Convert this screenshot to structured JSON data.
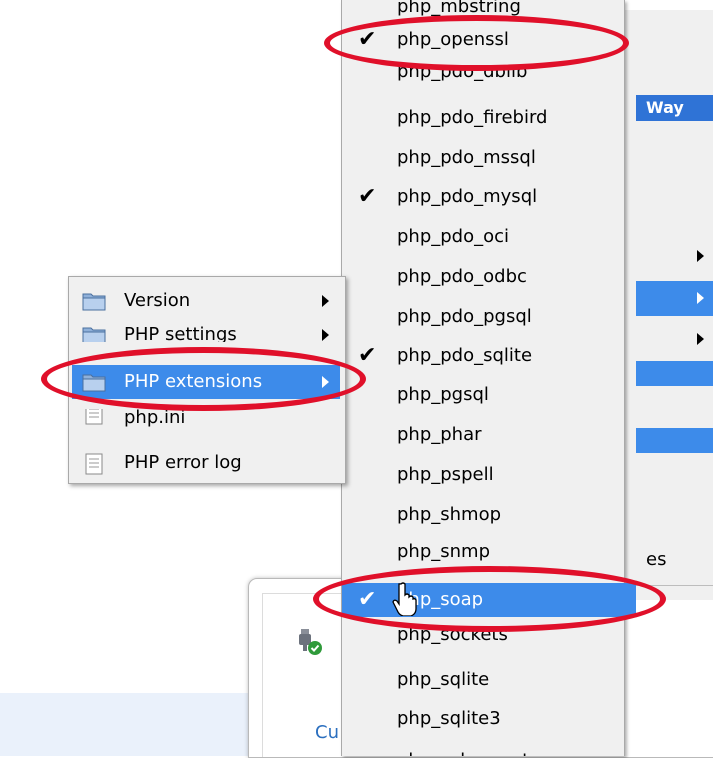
{
  "background_menu": {
    "header_label": "Way",
    "partial_text": "es"
  },
  "extensions_menu": {
    "items": [
      {
        "label": "php_openssl",
        "checked": true
      },
      {
        "label": "php_pdo_dblib",
        "checked": false
      },
      {
        "label": "php_pdo_firebird",
        "checked": false
      },
      {
        "label": "php_pdo_mssql",
        "checked": false
      },
      {
        "label": "php_pdo_mysql",
        "checked": true
      },
      {
        "label": "php_pdo_oci",
        "checked": false
      },
      {
        "label": "php_pdo_odbc",
        "checked": false
      },
      {
        "label": "php_pdo_pgsql",
        "checked": false
      },
      {
        "label": "php_pdo_sqlite",
        "checked": true
      },
      {
        "label": "php_pgsql",
        "checked": false
      },
      {
        "label": "php_phar",
        "checked": false
      },
      {
        "label": "php_pspell",
        "checked": false
      },
      {
        "label": "php_shmop",
        "checked": false
      },
      {
        "label": "php_snmp",
        "checked": false
      },
      {
        "label": "php_soap",
        "checked": true,
        "highlighted": true
      },
      {
        "label": "php_sockets",
        "checked": false
      },
      {
        "label": "php_sqlite",
        "checked": false
      },
      {
        "label": "php_sqlite3",
        "checked": false
      },
      {
        "label": "php_sybase_ct",
        "checked": false
      }
    ],
    "check_glyph": "✔"
  },
  "php_menu": {
    "items": [
      {
        "label": "Version",
        "icon": "folder-icon",
        "submenu": true
      },
      {
        "label": "PHP settings",
        "icon": "folder-icon",
        "submenu": true
      },
      {
        "label": "PHP extensions",
        "icon": "folder-icon",
        "submenu": true,
        "highlighted": true
      },
      {
        "label": "php.ini",
        "icon": "document-icon",
        "submenu": false
      },
      {
        "label": "PHP error log",
        "icon": "document-icon",
        "submenu": false
      }
    ]
  },
  "tray_window": {
    "link_text": "Cu",
    "icon": "wamp-server-icon"
  },
  "annotation": {
    "color": "#e0102a"
  },
  "colors": {
    "highlight": "#3d8bea",
    "menu_bg": "#f0f0f0"
  }
}
